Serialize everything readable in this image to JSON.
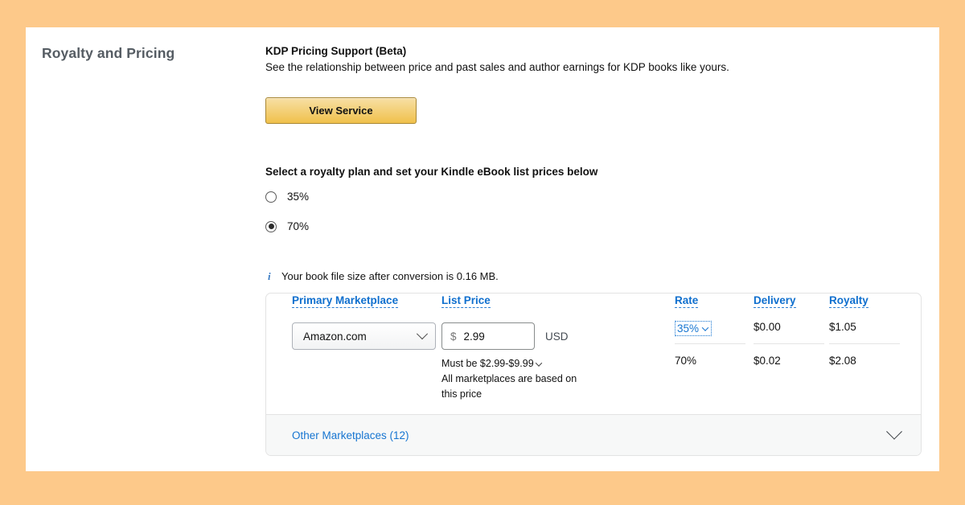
{
  "section": {
    "title": "Royalty and Pricing"
  },
  "kdp_support": {
    "heading": "KDP Pricing Support (Beta)",
    "description": "See the relationship between price and past sales and author earnings for KDP books like yours.",
    "button_label": "View Service"
  },
  "royalty_plan": {
    "prompt": "Select a royalty plan and set your Kindle eBook list prices below",
    "options": [
      {
        "label": "35%",
        "selected": false
      },
      {
        "label": "70%",
        "selected": true
      }
    ]
  },
  "notice": {
    "icon": "info-icon",
    "glyph": "i",
    "text": "Your book file size after conversion is 0.16 MB."
  },
  "pricing_table": {
    "headers": {
      "marketplace": "Primary Marketplace",
      "list_price": "List Price",
      "rate": "Rate",
      "delivery": "Delivery",
      "royalty": "Royalty"
    },
    "marketplace_value": "Amazon.com",
    "price": {
      "currency_symbol": "$",
      "value": "2.99",
      "currency_code": "USD",
      "hint_range": "Must be $2.99-$9.99",
      "hint_note_line1": "All marketplaces are based on",
      "hint_note_line2": "this price"
    },
    "rows": [
      {
        "rate": "35%",
        "delivery": "$0.00",
        "royalty": "$1.05",
        "rate_is_link": true
      },
      {
        "rate": "70%",
        "delivery": "$0.02",
        "royalty": "$2.08",
        "rate_is_link": false
      }
    ]
  },
  "footer": {
    "other_marketplaces_label": "Other Marketplaces (12)",
    "expand_icon": "chevron-down-icon"
  },
  "colors": {
    "page_background": "#FDC98A",
    "panel": "#FFFFFF",
    "link_blue": "#1675D1",
    "header_blue": "#0F6FCE",
    "button_gold": "#F0C14B",
    "button_border": "#A88734",
    "title_gray": "#555C63"
  }
}
